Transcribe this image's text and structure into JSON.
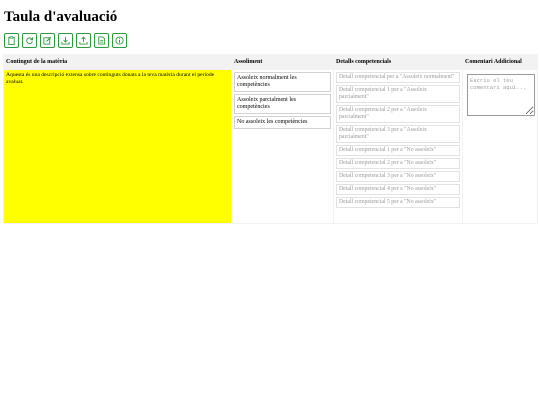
{
  "page": {
    "title": "Taula d'avaluació"
  },
  "toolbar": {
    "buttons": [
      {
        "icon": "clipboard-icon"
      },
      {
        "icon": "refresh-icon"
      },
      {
        "icon": "edit-icon"
      },
      {
        "icon": "download-icon"
      },
      {
        "icon": "upload-icon"
      },
      {
        "icon": "document-icon"
      },
      {
        "icon": "info-icon"
      }
    ],
    "accent_color": "#2e9a3e"
  },
  "table": {
    "headers": {
      "content": "Contingut de la matèria",
      "achievement": "Assoliment",
      "details": "Detalls competencials",
      "comment": "Comentari Addicional"
    },
    "content_text": "Aquesta és una descripció extensa sobre continguts donats a la teva matèria durant el període avaluat.",
    "content_bg": "#ffff00",
    "achievements": [
      "Assoleix normalment les competències",
      "Assoleix parcialment les competències",
      "No assoleix les competències"
    ],
    "details": [
      "Detall competencial per a \"Assoleix normalment\"",
      "Detall competencial 1 per a \"Assoleix parcialment\"",
      "Detall competencial 2 per a \"Assoleix parcialment\"",
      "Detall competencial 3 per a \"Assoleix parcialment\"",
      "Detall competencial 1 per a \"No assoleix\"",
      "Detall competencial 2 per a \"No assoleix\"",
      "Detall competencial 3 per a \"No assoleix\"",
      "Detall competencial 4 per a \"No assoleix\"",
      "Detall competencial 5 per a \"No assoleix\""
    ],
    "comment_placeholder": "Escriu el teu comentari aquí..."
  }
}
